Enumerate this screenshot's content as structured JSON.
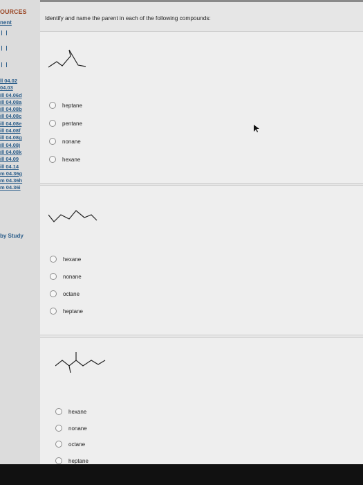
{
  "sidebar": {
    "title": "OURCES",
    "subtitle": "nent",
    "links": [
      "ll 04.02",
      "04.03",
      "ill 04.06d",
      "ill 04.08a",
      "ill 04.08b",
      "ill 04.08c",
      "ill 04.08e",
      "ill 04.08f",
      "ill 04.08g",
      "ill 04.08j",
      "ill 04.08k",
      "ill 04.09",
      "ill 04.14",
      "m 04.36g",
      "m 04.36h",
      "m 04.36i"
    ],
    "study_label": "by Study"
  },
  "main": {
    "prompt": "Identify and name the parent in each of the following compounds:",
    "questions": [
      {
        "options": [
          "heptane",
          "pentane",
          "nonane",
          "hexane"
        ]
      },
      {
        "options": [
          "hexane",
          "nonane",
          "octane",
          "heptane"
        ]
      },
      {
        "options": [
          "hexane",
          "nonane",
          "octane",
          "heptane"
        ]
      }
    ]
  },
  "colors": {
    "link": "#2a5d8a",
    "title": "#9b4a2a",
    "panel": "#eeeeee",
    "background": "#e6e6e6"
  }
}
